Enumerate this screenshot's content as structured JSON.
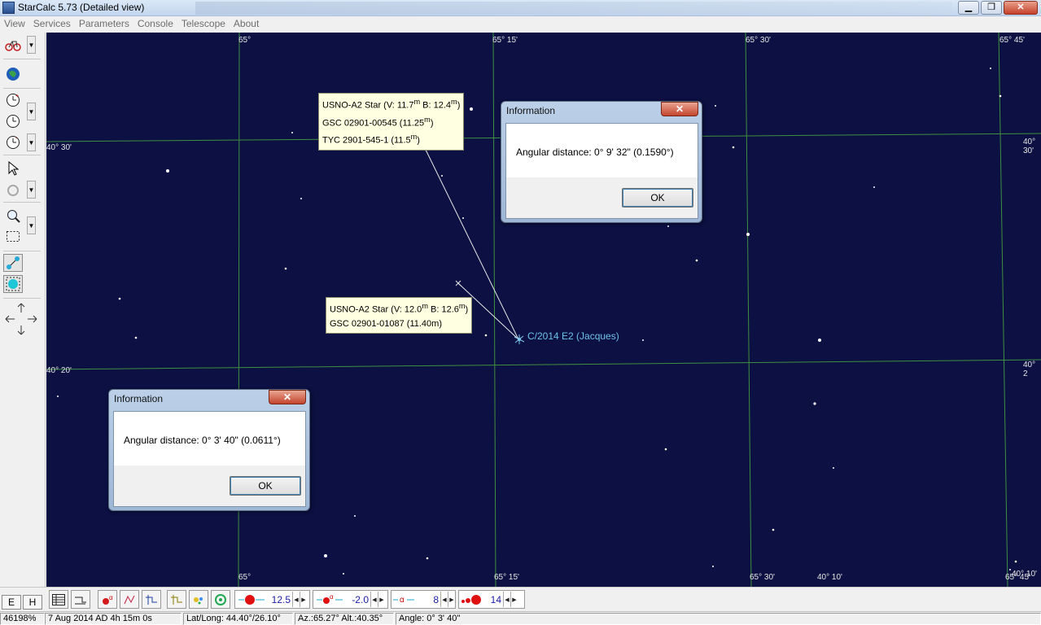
{
  "window": {
    "title": "StarCalc 5.73 (Detailed view)",
    "controls": {
      "minimize": "▁",
      "maximize": "❐",
      "close": "✕"
    }
  },
  "menu": [
    "View",
    "Services",
    "Parameters",
    "Console",
    "Telescope",
    "About"
  ],
  "left_toolbar": {
    "icons": [
      "bicycle-icon",
      "globe-icon",
      "clock-forward-icon",
      "clock-icon",
      "clock-back-icon",
      "pointer-icon",
      "rotate-icon",
      "zoom-icon",
      "select-rectangle-icon",
      "measure-icon",
      "target-icon",
      "pan-arrows-icon"
    ]
  },
  "sky_map": {
    "ra_labels_top": [
      "65°",
      "65° 15'",
      "65° 30'",
      "65° 45'"
    ],
    "ra_labels_bottom": [
      "65°",
      "65° 15'",
      "65° 30'",
      "40° 10'",
      "65° 45'",
      "40° 10'"
    ],
    "dec_labels_left": [
      "40° 30'",
      "40° 20'"
    ],
    "dec_labels_right": [
      "40° 30'",
      "40° 2"
    ],
    "tooltip_1": {
      "line1_prefix": "USNO-A2 Star (V: 11.7",
      "line1_mid": " B: 12.4",
      "line1_suffix": ")",
      "line2_prefix": "GSC 02901-00545 (11.25",
      "line2_suffix": ")",
      "line3_prefix": "TYC 2901-545-1 (11.5",
      "line3_suffix": ")",
      "superscript": "m"
    },
    "tooltip_2": {
      "line1_prefix": "USNO-A2 Star (V: 12.0",
      "line1_mid": " B: 12.6",
      "line1_suffix": ")",
      "line2": "GSC 02901-01087 (11.40m)",
      "superscript": "m"
    },
    "comet_label": "C/2014 E2 (Jacques)"
  },
  "dialogs": [
    {
      "title": "Information",
      "message": "Angular distance: 0° 9' 32\" (0.1590°)",
      "ok_label": "OK",
      "close_label": "✕"
    },
    {
      "title": "Information",
      "message": "Angular distance: 0° 3' 40\" (0.0611°)",
      "ok_label": "OK",
      "close_label": "✕"
    }
  ],
  "bottom_toolbar": {
    "mode_buttons": [
      "E",
      "H"
    ],
    "steppers": [
      {
        "name": "star-magnitude-limit",
        "value": "12.5"
      },
      {
        "name": "deep-sky-magnitude-limit",
        "value": "-2.0"
      },
      {
        "name": "label-count",
        "value": "8"
      },
      {
        "name": "star-size",
        "value": "14"
      }
    ],
    "stepper_arrows": {
      "left": "◀",
      "right": "▶"
    }
  },
  "status_bar": {
    "zoom": "46198%",
    "datetime": "7 Aug 2014 AD 4h 15m 0s",
    "latlong": "Lat/Long: 44.40°/26.10°",
    "azalt": "Az.:65.27° Alt.:40.35°",
    "angle": "Angle:  0° 3' 40''"
  },
  "colors": {
    "sky_background": "#0c1042",
    "grid_lines": "#3f8f3f",
    "star": "#ffffff",
    "comet_label": "#6fc2e8",
    "status_value": "#1a1aa8"
  }
}
